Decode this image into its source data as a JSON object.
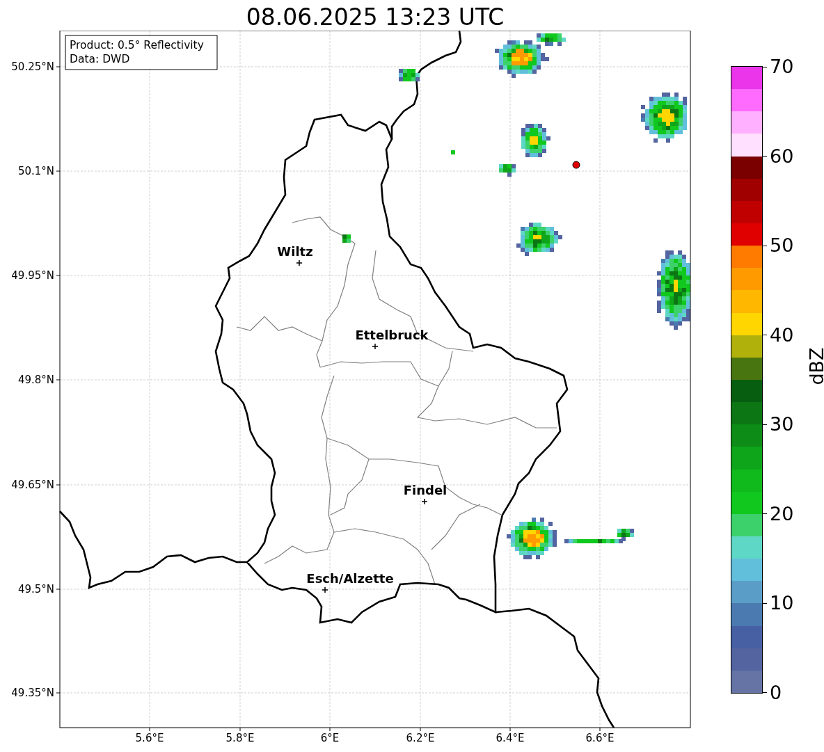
{
  "title": "08.06.2025 13:23 UTC",
  "info_box": [
    "Product: 0.5° Reflectivity",
    "Data: DWD"
  ],
  "cities": [
    {
      "name": "Wiltz"
    },
    {
      "name": "Ettelbruck"
    },
    {
      "name": "Findel"
    },
    {
      "name": "Esch/Alzette"
    }
  ],
  "x_ticks": [
    "5.6°E",
    "5.8°E",
    "6°E",
    "6.2°E",
    "6.4°E",
    "6.6°E"
  ],
  "y_ticks": [
    "50.25°N",
    "50.1°N",
    "49.95°N",
    "49.8°N",
    "49.65°N",
    "49.5°N",
    "49.35°N"
  ],
  "colorbar": {
    "label": "dBZ",
    "ticks": [
      "70",
      "60",
      "50",
      "40",
      "30",
      "20",
      "10",
      "0"
    ],
    "bins": [
      {
        "color": "#ea35ea"
      },
      {
        "color": "#ff6aff"
      },
      {
        "color": "#ffb0ff"
      },
      {
        "color": "#ffe0ff"
      },
      {
        "color": "#7a0000"
      },
      {
        "color": "#a00000"
      },
      {
        "color": "#c00000"
      },
      {
        "color": "#e00000"
      },
      {
        "color": "#ff7b00"
      },
      {
        "color": "#ff9a00"
      },
      {
        "color": "#ffb700"
      },
      {
        "color": "#ffd600"
      },
      {
        "color": "#b0b20b"
      },
      {
        "color": "#487510"
      },
      {
        "color": "#075e10"
      },
      {
        "color": "#0b7613"
      },
      {
        "color": "#0d8d17"
      },
      {
        "color": "#0fa51a"
      },
      {
        "color": "#10b91c"
      },
      {
        "color": "#11c81e"
      },
      {
        "color": "#3dd16b"
      },
      {
        "color": "#5fd7c6"
      },
      {
        "color": "#62bfdb"
      },
      {
        "color": "#5a9ec8"
      },
      {
        "color": "#4a7ab0"
      },
      {
        "color": "#4660a3"
      },
      {
        "color": "#5364a0"
      },
      {
        "color": "#6673a5"
      }
    ]
  }
}
